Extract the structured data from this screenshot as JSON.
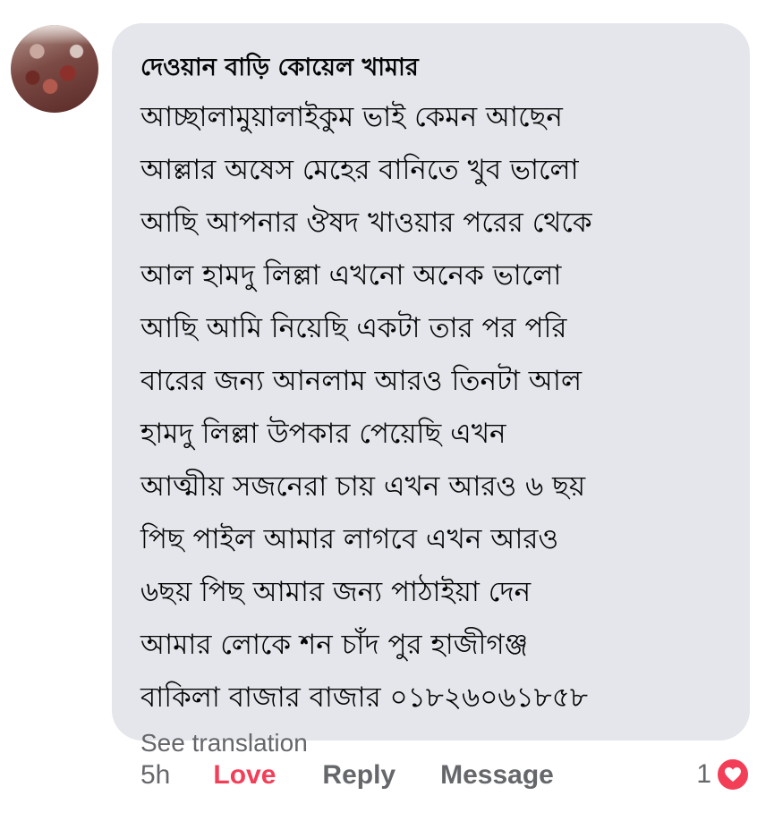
{
  "comment": {
    "author": "দেওয়ান বাড়ি কোয়েল খামার",
    "lines": [
      "আচ্ছালামুয়ালাইকুম ভাই কেমন আছেন",
      "আল্লার অষেস মেহের বানিতে খুব ভালো",
      "আছি আপনার ঔষদ খাওয়ার পরের থেকে",
      "আল হামদু লিল্লা  এখনো অনেক ভালো",
      "আছি আমি নিয়েছি একটা তার পর পরি",
      "বারের জন্য আনলাম আরও তিনটা আল",
      "হামদু লিল্লা উপকার পেয়েছি এখন",
      "আত্মীয় সজনেরা চায় এখন আরও ৬ ছয়",
      "পিছ পাইল আমার লাগবে এখন আরও",
      "৬ছয় পিছ আমার জন্য পাঠাইয়া দেন",
      "আমার লোকে শন চাঁদ পুর হাজীগঞ্জ",
      "বাকিলা বাজার বাজার ০১৮২৬০৬১৮৫৮"
    ],
    "see_translation": "See translation"
  },
  "actions": {
    "time": "5h",
    "love": "Love",
    "reply": "Reply",
    "message": "Message"
  },
  "reactions": {
    "count": "1",
    "icon": "heart-icon"
  },
  "colors": {
    "bubble": "#e4e6eb",
    "love": "#f33e58",
    "secondary_text": "#65676b",
    "primary_text": "#050505"
  }
}
